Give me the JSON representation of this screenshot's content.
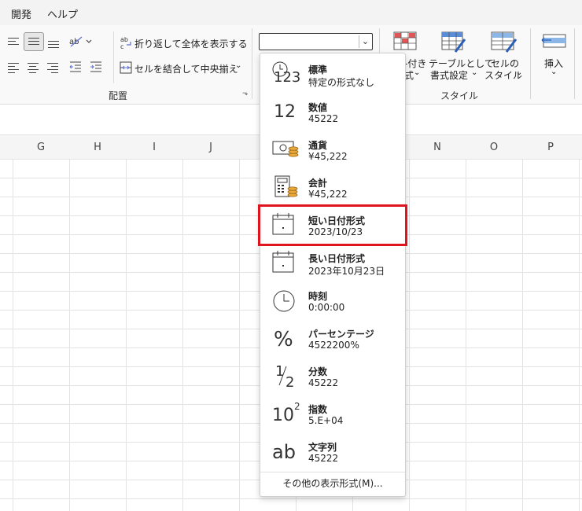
{
  "menu": {
    "items": [
      "開発",
      "ヘルプ"
    ]
  },
  "ribbon": {
    "wrap_text": "折り返して全体を表示する",
    "merge_center": "セルを結合して中央揃え",
    "alignment_group": "配置",
    "style_group": "スタイル",
    "cond_format_line1": "-付き",
    "cond_format_line2": "式",
    "table_format_line1": "テーブルとして",
    "table_format_line2": "書式設定",
    "cell_style_line1": "セルの",
    "cell_style_line2": "スタイル",
    "insert": "挿入"
  },
  "number_format_combo": {
    "value": ""
  },
  "columns": [
    "G",
    "H",
    "I",
    "J",
    "N",
    "O",
    "P"
  ],
  "dropdown": {
    "items": [
      {
        "name": "標準",
        "example": "特定の形式なし",
        "icon": "clock-123-icon"
      },
      {
        "name": "数値",
        "example": "45222",
        "icon": "number-12-icon"
      },
      {
        "name": "通貨",
        "example": "¥45,222",
        "icon": "currency-icon"
      },
      {
        "name": "会計",
        "example": " ¥45,222",
        "icon": "calculator-icon"
      },
      {
        "name": "短い日付形式",
        "example": "2023/10/23",
        "icon": "calendar-icon"
      },
      {
        "name": "長い日付形式",
        "example": "2023年10月23日",
        "icon": "calendar-icon"
      },
      {
        "name": "時刻",
        "example": "0:00:00",
        "icon": "clock-icon"
      },
      {
        "name": "パーセンテージ",
        "example": "4522200%",
        "icon": "percent-icon"
      },
      {
        "name": "分数",
        "example": "45222",
        "icon": "fraction-icon"
      },
      {
        "name": "指数",
        "example": "5.E+04",
        "icon": "exponent-icon"
      },
      {
        "name": "文字列",
        "example": "45222",
        "icon": "text-ab-icon"
      }
    ],
    "more_formats": "その他の表示形式(M)...",
    "highlighted": "短い日付形式"
  },
  "icon_text": {
    "num123": "123",
    "num12": "12",
    "pct": "%",
    "frac_num": "1",
    "frac_den": "2",
    "exp_base": "10",
    "exp_pow": "2",
    "ab": "ab"
  },
  "colors": {
    "highlight": "#e0141e",
    "coin": "#e9a83a"
  }
}
